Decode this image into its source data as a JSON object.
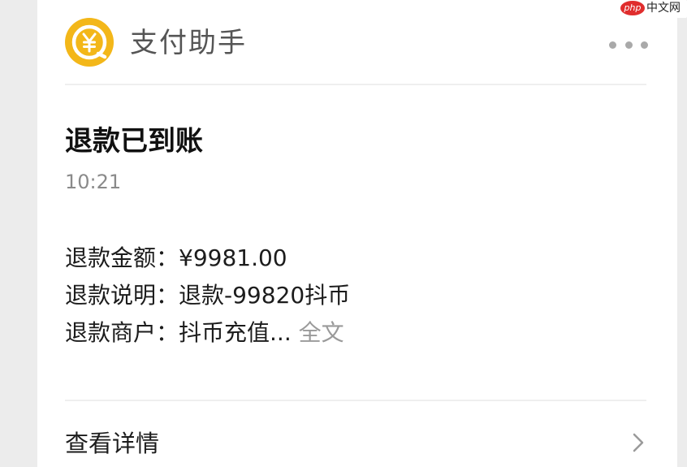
{
  "header": {
    "app_name": "支付助手",
    "avatar_icon": "yen-coin-icon",
    "more_icon": "more-dots-icon"
  },
  "message": {
    "title": "退款已到账",
    "time": "10:21",
    "rows": [
      {
        "label": "退款金额：",
        "value": "¥9981.00"
      },
      {
        "label": "退款说明：",
        "value": "退款-99820抖币"
      },
      {
        "label": "退款商户：",
        "value": "抖币充值...",
        "extra": "全文"
      }
    ]
  },
  "footer": {
    "details_label": "查看详情",
    "chevron_icon": "chevron-right-icon"
  },
  "watermark": {
    "logo": "php",
    "text": "中文网"
  },
  "colors": {
    "avatar": "#f3b719",
    "page_background": "#ececec",
    "card": "#ffffff"
  }
}
